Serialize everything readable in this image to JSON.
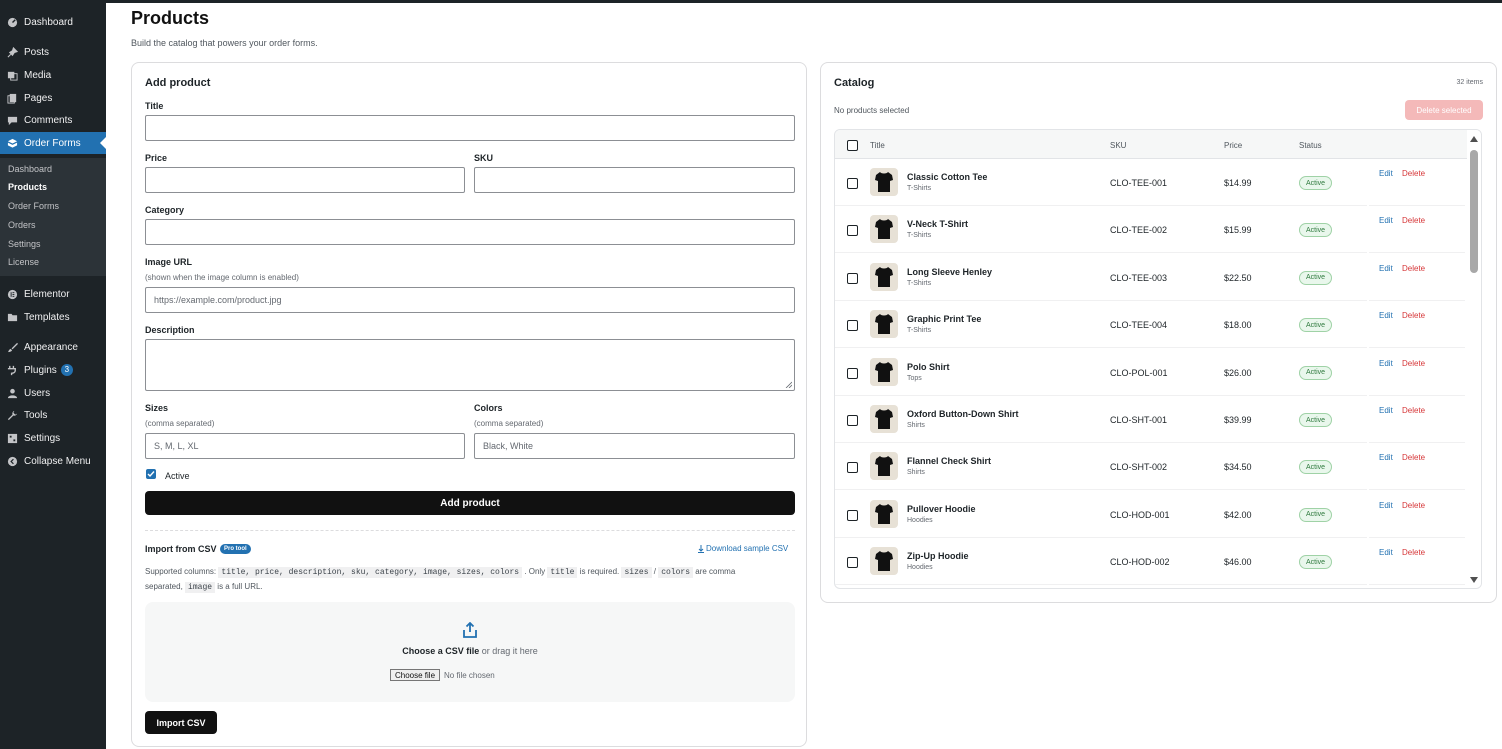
{
  "sidebar": {
    "items": [
      {
        "label": "Dashboard",
        "icon": "dashboard-icon"
      },
      {
        "label": "Posts",
        "icon": "pin-icon"
      },
      {
        "label": "Media",
        "icon": "media-icon"
      },
      {
        "label": "Pages",
        "icon": "pages-icon"
      },
      {
        "label": "Comments",
        "icon": "comments-icon"
      },
      {
        "label": "Order Forms",
        "icon": "cube-icon"
      },
      {
        "label": "Elementor",
        "icon": "elementor-icon"
      },
      {
        "label": "Templates",
        "icon": "folder-icon"
      },
      {
        "label": "Appearance",
        "icon": "brush-icon"
      },
      {
        "label": "Plugins",
        "icon": "plug-icon",
        "badge": "3"
      },
      {
        "label": "Users",
        "icon": "user-icon"
      },
      {
        "label": "Tools",
        "icon": "wrench-icon"
      },
      {
        "label": "Settings",
        "icon": "settings-icon"
      },
      {
        "label": "Collapse Menu",
        "icon": "collapse-icon"
      }
    ],
    "submenu": [
      "Dashboard",
      "Products",
      "Order Forms",
      "Orders",
      "Settings",
      "License"
    ]
  },
  "page": {
    "title": "Products",
    "subtitle": "Build the catalog that powers your order forms."
  },
  "add_product": {
    "heading": "Add product",
    "title_label": "Title",
    "price_label": "Price",
    "sku_label": "SKU",
    "category_label": "Category",
    "image_label": "Image URL",
    "image_hint": "(shown when the image column is enabled)",
    "image_placeholder": "https://example.com/product.jpg",
    "description_label": "Description",
    "sizes_label": "Sizes",
    "sizes_hint": "(comma separated)",
    "sizes_placeholder": "S, M, L, XL",
    "colors_label": "Colors",
    "colors_hint": "(comma separated)",
    "colors_placeholder": "Black, White",
    "active_label": "Active",
    "active_checked": true,
    "submit_label": "Add product"
  },
  "csv": {
    "heading": "Import from CSV",
    "pro_badge": "Pro tool",
    "download_link": "Download sample CSV",
    "supported_prefix": "Supported columns:",
    "columns_code": "title, price, description, sku, category, image, sizes, colors",
    "only_text": ". Only",
    "title_code": "title",
    "required_text": "is required.",
    "sizes_code": "sizes",
    "slash": "/",
    "colors_code": "colors",
    "comma_text": "are comma",
    "separated_text": "separated,",
    "image_code": "image",
    "full_url_text": "is a full URL.",
    "drop_choose": "Choose a CSV file",
    "drop_or": "or drag it here",
    "choose_button": "Choose file",
    "no_file": "No file chosen",
    "import_label": "Import CSV"
  },
  "catalog": {
    "heading": "Catalog",
    "count": "32 items",
    "selection": "No products selected",
    "delete_selected": "Delete selected",
    "columns": [
      "Title",
      "SKU",
      "Price",
      "Status"
    ],
    "edit_label": "Edit",
    "delete_label": "Delete",
    "rows": [
      {
        "title": "Classic Cotton Tee",
        "category": "T-Shirts",
        "sku": "CLO-TEE-001",
        "price": "$14.99",
        "status": "Active"
      },
      {
        "title": "V-Neck T-Shirt",
        "category": "T-Shirts",
        "sku": "CLO-TEE-002",
        "price": "$15.99",
        "status": "Active"
      },
      {
        "title": "Long Sleeve Henley",
        "category": "T-Shirts",
        "sku": "CLO-TEE-003",
        "price": "$22.50",
        "status": "Active"
      },
      {
        "title": "Graphic Print Tee",
        "category": "T-Shirts",
        "sku": "CLO-TEE-004",
        "price": "$18.00",
        "status": "Active"
      },
      {
        "title": "Polo Shirt",
        "category": "Tops",
        "sku": "CLO-POL-001",
        "price": "$26.00",
        "status": "Active"
      },
      {
        "title": "Oxford Button-Down Shirt",
        "category": "Shirts",
        "sku": "CLO-SHT-001",
        "price": "$39.99",
        "status": "Active"
      },
      {
        "title": "Flannel Check Shirt",
        "category": "Shirts",
        "sku": "CLO-SHT-002",
        "price": "$34.50",
        "status": "Active"
      },
      {
        "title": "Pullover Hoodie",
        "category": "Hoodies",
        "sku": "CLO-HOD-001",
        "price": "$42.00",
        "status": "Active"
      },
      {
        "title": "Zip-Up Hoodie",
        "category": "Hoodies",
        "sku": "CLO-HOD-002",
        "price": "$46.00",
        "status": "Active"
      }
    ]
  },
  "colors": {
    "accent": "#2271b1",
    "sidebar": "#1d2327",
    "danger": "#d63638",
    "success": "#2f7a3e"
  }
}
